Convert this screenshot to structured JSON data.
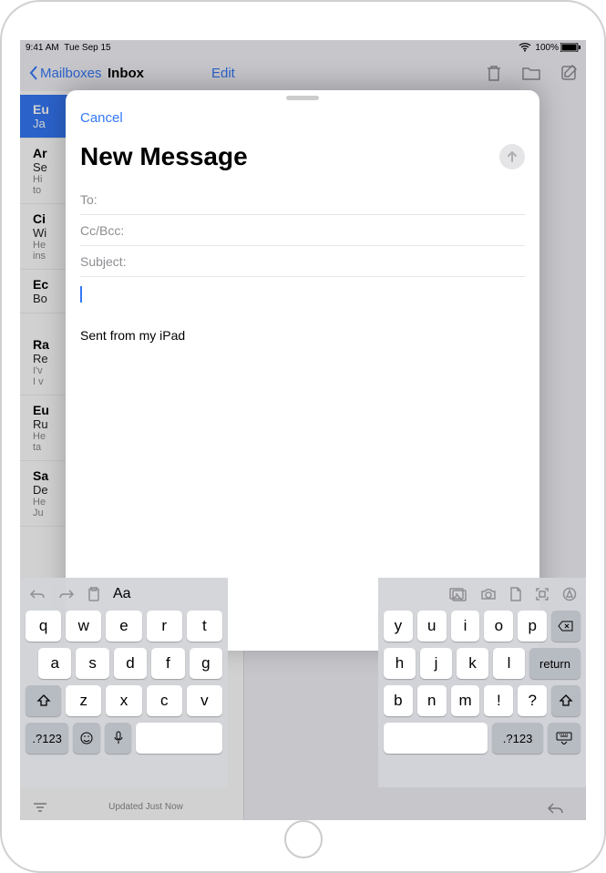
{
  "status": {
    "time": "9:41 AM",
    "date": "Tue Sep 15",
    "battery": "100%"
  },
  "mail": {
    "back": "Mailboxes",
    "title": "Inbox",
    "edit": "Edit",
    "footer": "Updated Just Now",
    "items": [
      {
        "from": "Eu",
        "subj": "Ja",
        "prev1": "",
        "prev2": ""
      },
      {
        "from": "Ar",
        "subj": "Se",
        "prev1": "Hi",
        "prev2": "to"
      },
      {
        "from": "Ci",
        "subj": "Wi",
        "prev1": "He",
        "prev2": "ins"
      },
      {
        "from": "Ec",
        "subj": "Bo",
        "prev1": "",
        "prev2": ""
      },
      {
        "from": "Ra",
        "subj": "Re",
        "prev1": "I'v",
        "prev2": "I v"
      },
      {
        "from": "Eu",
        "subj": "Ru",
        "prev1": "He",
        "prev2": "ta"
      },
      {
        "from": "Sa",
        "subj": "De",
        "prev1": "He",
        "prev2": "Ju"
      }
    ]
  },
  "compose": {
    "cancel": "Cancel",
    "title": "New Message",
    "to": "To:",
    "ccbcc": "Cc/Bcc:",
    "subject": "Subject:",
    "signature": "Sent from my iPad"
  },
  "keyboard": {
    "aa": "Aa",
    "left": {
      "r1": [
        "q",
        "w",
        "e",
        "r",
        "t"
      ],
      "r2": [
        "a",
        "s",
        "d",
        "f",
        "g"
      ],
      "r3": [
        "z",
        "x",
        "c",
        "v"
      ],
      "numkey": ".?123"
    },
    "right": {
      "r1": [
        "y",
        "u",
        "i",
        "o",
        "p"
      ],
      "r2": [
        "h",
        "j",
        "k",
        "l"
      ],
      "r3": [
        "b",
        "n",
        "m",
        "!",
        "?"
      ],
      "return": "return",
      "numkey": ".?123"
    }
  }
}
